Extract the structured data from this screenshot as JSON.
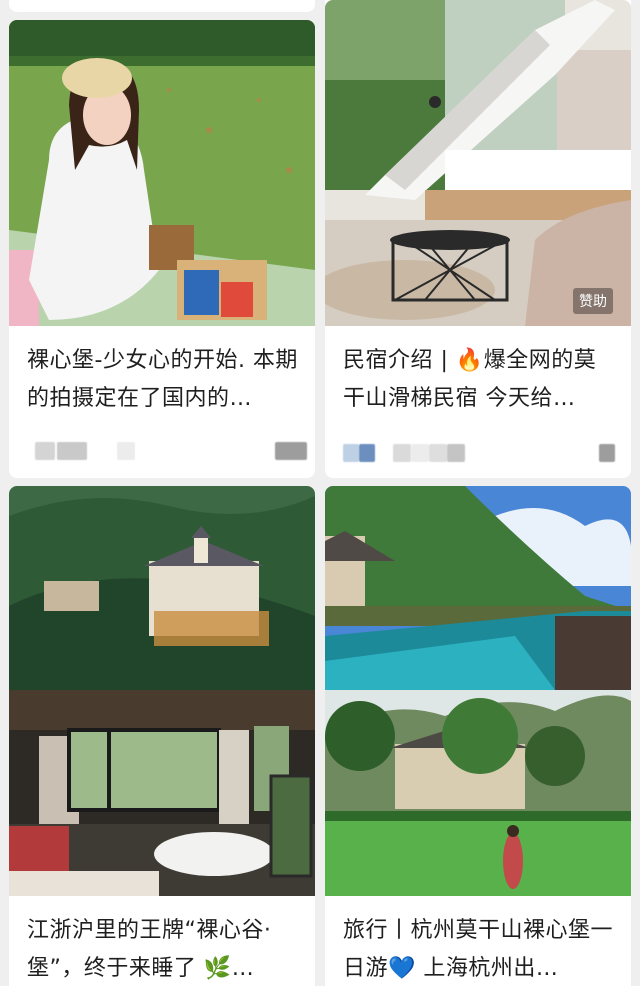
{
  "feed": {
    "cards": [
      {
        "title": "裸心堡-少女心的开始. 本期的拍摄定在了国内的…",
        "image": "girl-in-white-dress-picnic-on-lawn"
      },
      {
        "title": "民宿介绍 | 🔥爆全网的莫干山滑梯民宿 今天给…",
        "image": "bedroom-with-white-slide",
        "badge": "赞助"
      },
      {
        "title": "江浙沪里的王牌“裸心谷·堡”，终于来睡了 🌿…",
        "image": "hilltop-castle-and-bathtub-room"
      },
      {
        "title": "旅行丨杭州莫干山裸心堡一日游💙 上海杭州出…",
        "image": "infinity-pool-and-lawn-villa"
      }
    ]
  },
  "colors": {
    "background": "#efefef",
    "card": "#ffffff",
    "title_text": "#1f1f1f",
    "blur_grey": "#c8c8c8",
    "blur_blue": "#8fa7c7"
  }
}
